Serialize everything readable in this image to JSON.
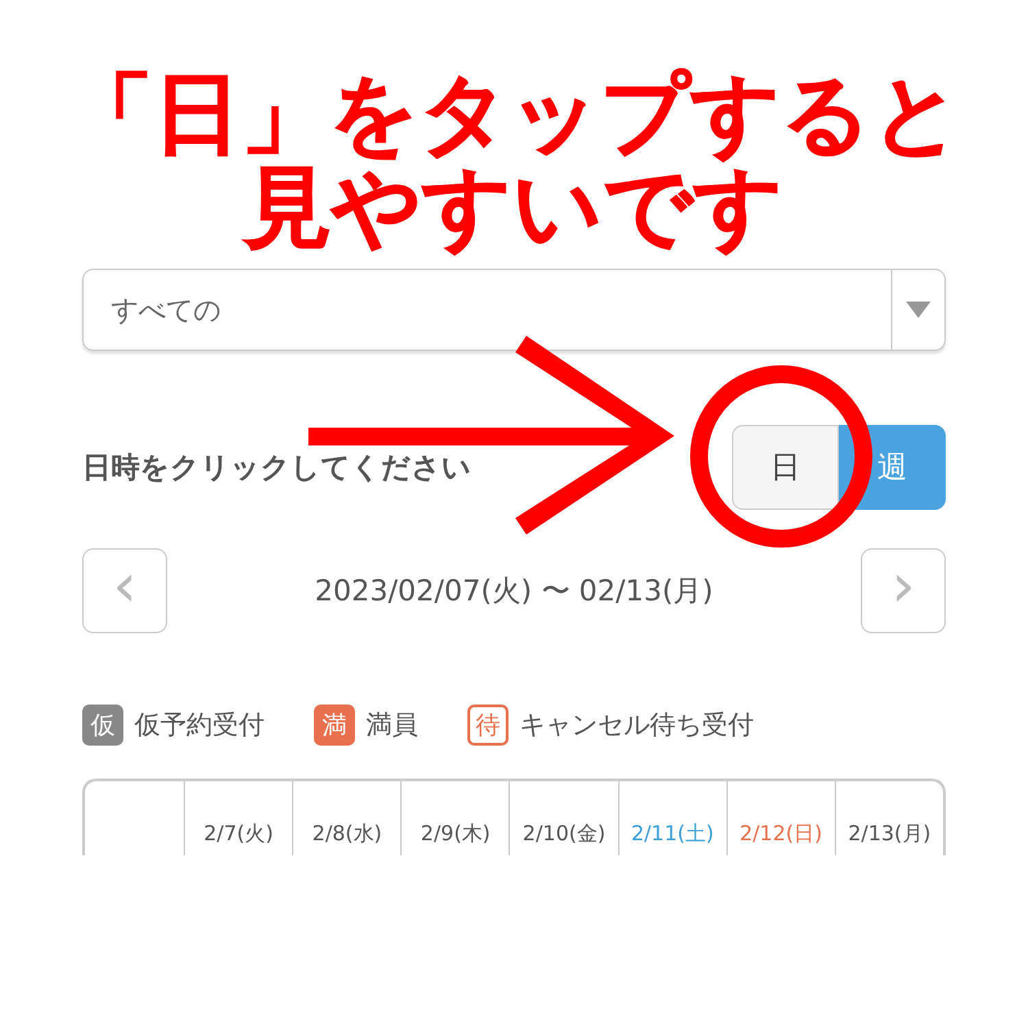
{
  "resource_select": {
    "value": "すべての"
  },
  "heading": "日時をクリックしてください",
  "view_toggle": [
    {
      "label": "日",
      "selected": false
    },
    {
      "label": "週",
      "selected": true
    }
  ],
  "date_nav": {
    "prev": "‹",
    "range": "2023/02/07(火) 〜 02/13(月)",
    "next": "›"
  },
  "legend": [
    {
      "badge": "仮",
      "label": "仮予約受付",
      "kind": "gray"
    },
    {
      "badge": "満",
      "label": "満員",
      "kind": "full"
    },
    {
      "badge": "待",
      "label": "キャンセル待ち受付",
      "kind": "outline"
    }
  ],
  "table": {
    "columns": [
      {
        "label": "2/7(火)",
        "kind": "weekday"
      },
      {
        "label": "2/8(水)",
        "kind": "weekday"
      },
      {
        "label": "2/9(木)",
        "kind": "weekday"
      },
      {
        "label": "2/10(金)",
        "kind": "weekday"
      },
      {
        "label": "2/11(土)",
        "kind": "saturday"
      },
      {
        "label": "2/12(日)",
        "kind": "sunday"
      },
      {
        "label": "2/13(月)",
        "kind": "weekday"
      }
    ]
  },
  "annotation": {
    "lines": [
      "「日」をタップすると",
      "見やすいです"
    ]
  }
}
